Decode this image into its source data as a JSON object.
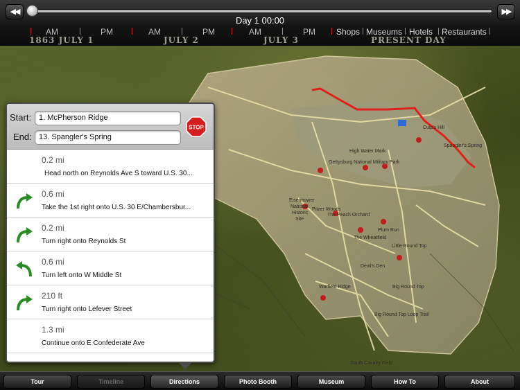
{
  "timeline": {
    "current_label": "Day 1 00:00",
    "period_labels": [
      "AM",
      "PM",
      "AM",
      "PM",
      "AM",
      "PM"
    ],
    "date_labels": [
      "1863 JULY 1",
      "JULY 2",
      "JULY 3",
      "PRESENT DAY"
    ],
    "category_labels": [
      "Shops",
      "Museums",
      "Hotels",
      "Restaurants"
    ]
  },
  "directions": {
    "start_label": "Start:",
    "end_label": "End:",
    "start_value": "1. McPherson Ridge",
    "end_value": "13. Spangler's Spring",
    "stop_label": "STOP",
    "steps": [
      {
        "distance": "0.2 mi",
        "instruction": "Head north on Reynolds Ave S toward U.S. 30...",
        "icon": "none"
      },
      {
        "distance": "0.6 mi",
        "instruction": "Take the 1st right onto U.S. 30 E/Chambersbur...",
        "icon": "turn-right-arrow-icon"
      },
      {
        "distance": "0.2 mi",
        "instruction": "Turn right onto Reynolds St",
        "icon": "turn-right-arrow-icon"
      },
      {
        "distance": "0.6 mi",
        "instruction": "Turn left onto W Middle St",
        "icon": "turn-left-arrow-icon"
      },
      {
        "distance": "210 ft",
        "instruction": "Turn right onto Lefever Street",
        "icon": "turn-right-arrow-icon"
      },
      {
        "distance": "1.3 mi",
        "instruction": "Continue onto E Confederate Ave",
        "icon": "none"
      }
    ]
  },
  "map": {
    "labels": [
      "Eisenhower",
      "National",
      "Historic",
      "Site",
      "Gettysburg National Military Park",
      "High Water Mark",
      "The Peach Orchard",
      "The Wheatfield",
      "Little Round Top",
      "Big Round Top",
      "Big Round Top Loop Trail",
      "South Cavalry Field",
      "Warfield Ridge",
      "Devil's Den",
      "Plum Run",
      "Culp's Hill",
      "Spangler's Spring",
      "Pitzer Woods"
    ],
    "route_color": "#e0201a"
  },
  "tabs": [
    {
      "label": "Tour",
      "state": "normal"
    },
    {
      "label": "Timeline",
      "state": "disabled"
    },
    {
      "label": "Directions",
      "state": "active"
    },
    {
      "label": "Photo Booth",
      "state": "normal"
    },
    {
      "label": "Museum",
      "state": "normal"
    },
    {
      "label": "How To",
      "state": "normal"
    },
    {
      "label": "About",
      "state": "normal"
    }
  ]
}
